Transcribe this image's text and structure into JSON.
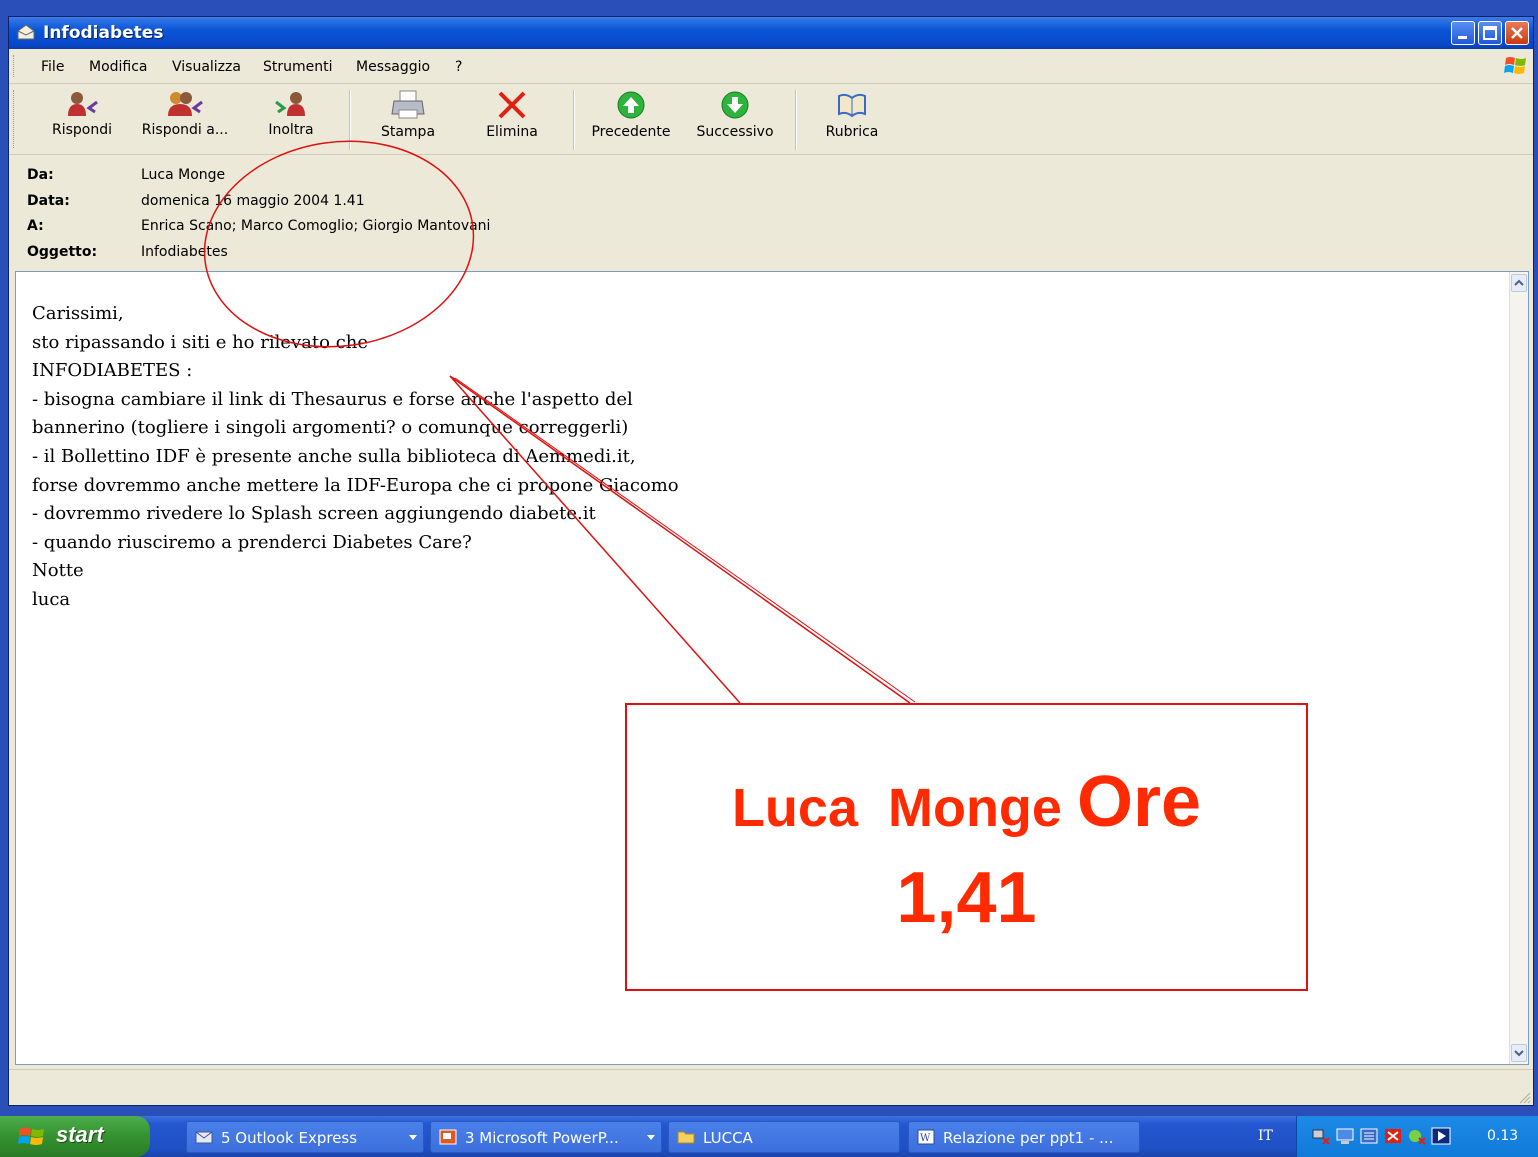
{
  "window": {
    "title": "Infodiabetes"
  },
  "menu": [
    "File",
    "Modifica",
    "Visualizza",
    "Strumenti",
    "Messaggio",
    "?"
  ],
  "toolbar": {
    "reply": "Rispondi",
    "reply_all": "Rispondi a...",
    "forward": "Inoltra",
    "print": "Stampa",
    "delete": "Elimina",
    "previous": "Precedente",
    "next": "Successivo",
    "address_book": "Rubrica"
  },
  "headers": {
    "from_label": "Da:",
    "from": "Luca Monge",
    "date_label": "Data:",
    "date": "domenica 16 maggio 2004 1.41",
    "to_label": "A:",
    "to": "Enrica Scano; Marco Comoglio; Giorgio Mantovani",
    "subject_label": "Oggetto:",
    "subject": "Infodiabetes"
  },
  "message": {
    "lines": [
      "Carissimi,",
      "sto ripassando i siti e ho rilevato che",
      "INFODIABETES :",
      "- bisogna cambiare il link di Thesaurus e forse anche l'aspetto del",
      "bannerino (togliere i singoli argomenti? o comunque correggerli)",
      "- il Bollettino IDF è presente anche sulla biblioteca di Aemmedi.it,",
      "forse dovremmo anche mettere la IDF-Europa che ci propone Giacomo",
      "- dovremmo rivedere lo Splash screen aggiungendo diabete.it",
      "- quando riusciremo a prenderci Diabetes Care?",
      "Notte",
      "luca"
    ]
  },
  "annotation": {
    "line1_a": "Luca  Monge",
    "line1_b": "Ore",
    "line2": "1,41",
    "color": "#ff2a00"
  },
  "taskbar": {
    "start": "start",
    "tasks": [
      "5 Outlook Express",
      "3 Microsoft PowerP...",
      "LUCCA",
      "Relazione per ppt1 - ..."
    ],
    "language": "IT",
    "clock": "0.13"
  }
}
